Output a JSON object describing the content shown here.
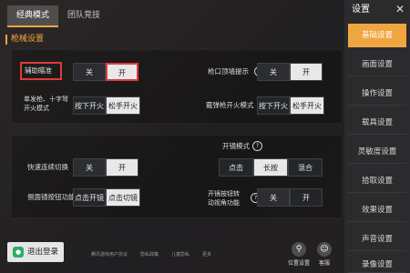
{
  "tabs": [
    "经典模式",
    "团队竞技"
  ],
  "section_title": "枪械设置",
  "settings": {
    "assist_aim": {
      "label": "辅助瞄准",
      "options": [
        "关",
        "开"
      ],
      "selected": "开"
    },
    "muzzle_tip": {
      "label": "枪口顶墙提示",
      "options": [
        "关",
        "开"
      ],
      "selected": "开"
    },
    "single_shot": {
      "label": "单发枪、十字弩开火模式",
      "options": [
        "按下开火",
        "松手开火"
      ],
      "selected": "松手开火"
    },
    "scope_shot": {
      "label": "霰弹枪开火模式",
      "options": [
        "按下开火",
        "松手开火"
      ],
      "selected": "松手开火"
    },
    "quick_switch": {
      "label": "快速连续切换",
      "options": [
        "关",
        "开"
      ],
      "selected": "开"
    },
    "open_mode": {
      "label": "开镜模式",
      "options": [
        "点击",
        "长按",
        "混合"
      ],
      "selected": "长按"
    },
    "side_scope": {
      "label": "侧面镜按钮功能",
      "options": [
        "点击开镜",
        "点击切镜"
      ],
      "selected": "点击切镜"
    },
    "open_btn_view": {
      "label": "开镜按钮转动视角功能",
      "options": [
        "关",
        "开"
      ],
      "selected": "开"
    }
  },
  "logout_label": "退出登录",
  "footer_links": [
    "腾讯游戏用户协议",
    "隐私政策",
    "儿童隐私",
    "更多"
  ],
  "bottom_icons": [
    {
      "icon": "location-icon",
      "label": "位置设置"
    },
    {
      "icon": "support-icon",
      "label": "客服"
    }
  ],
  "sidebar": {
    "title": "设置",
    "items": [
      "基础设置",
      "画面设置",
      "操作设置",
      "载具设置",
      "灵敏度设置",
      "拾取设置",
      "效果设置",
      "声音设置",
      "录像设置"
    ],
    "active": "基础设置"
  },
  "colors": {
    "accent": "#f0a640",
    "highlight_box": "#e03a3a"
  }
}
